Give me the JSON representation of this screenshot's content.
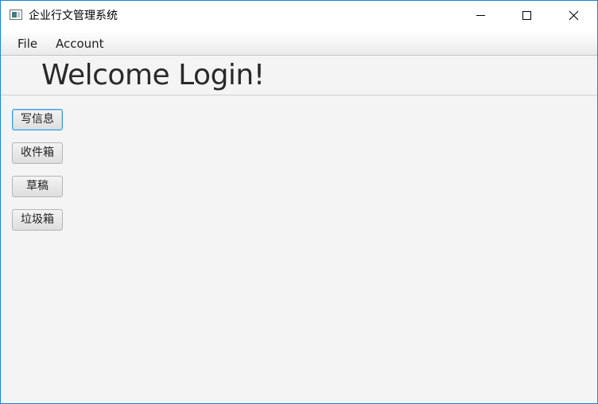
{
  "window": {
    "title": "企业行文管理系统",
    "controls": {
      "minimize_icon": "minimize-icon",
      "maximize_icon": "maximize-icon",
      "close_icon": "close-icon"
    }
  },
  "menubar": {
    "items": [
      {
        "label": "File"
      },
      {
        "label": "Account"
      }
    ]
  },
  "main": {
    "heading": "Welcome Login!",
    "buttons": [
      {
        "label": "写信息",
        "focused": true
      },
      {
        "label": "收件箱",
        "focused": false
      },
      {
        "label": "草稿",
        "focused": false
      },
      {
        "label": "垃圾箱",
        "focused": false
      }
    ]
  },
  "colors": {
    "window_border": "#1883d7",
    "background": "#f4f4f4",
    "focus_ring": "#3a9adb"
  }
}
